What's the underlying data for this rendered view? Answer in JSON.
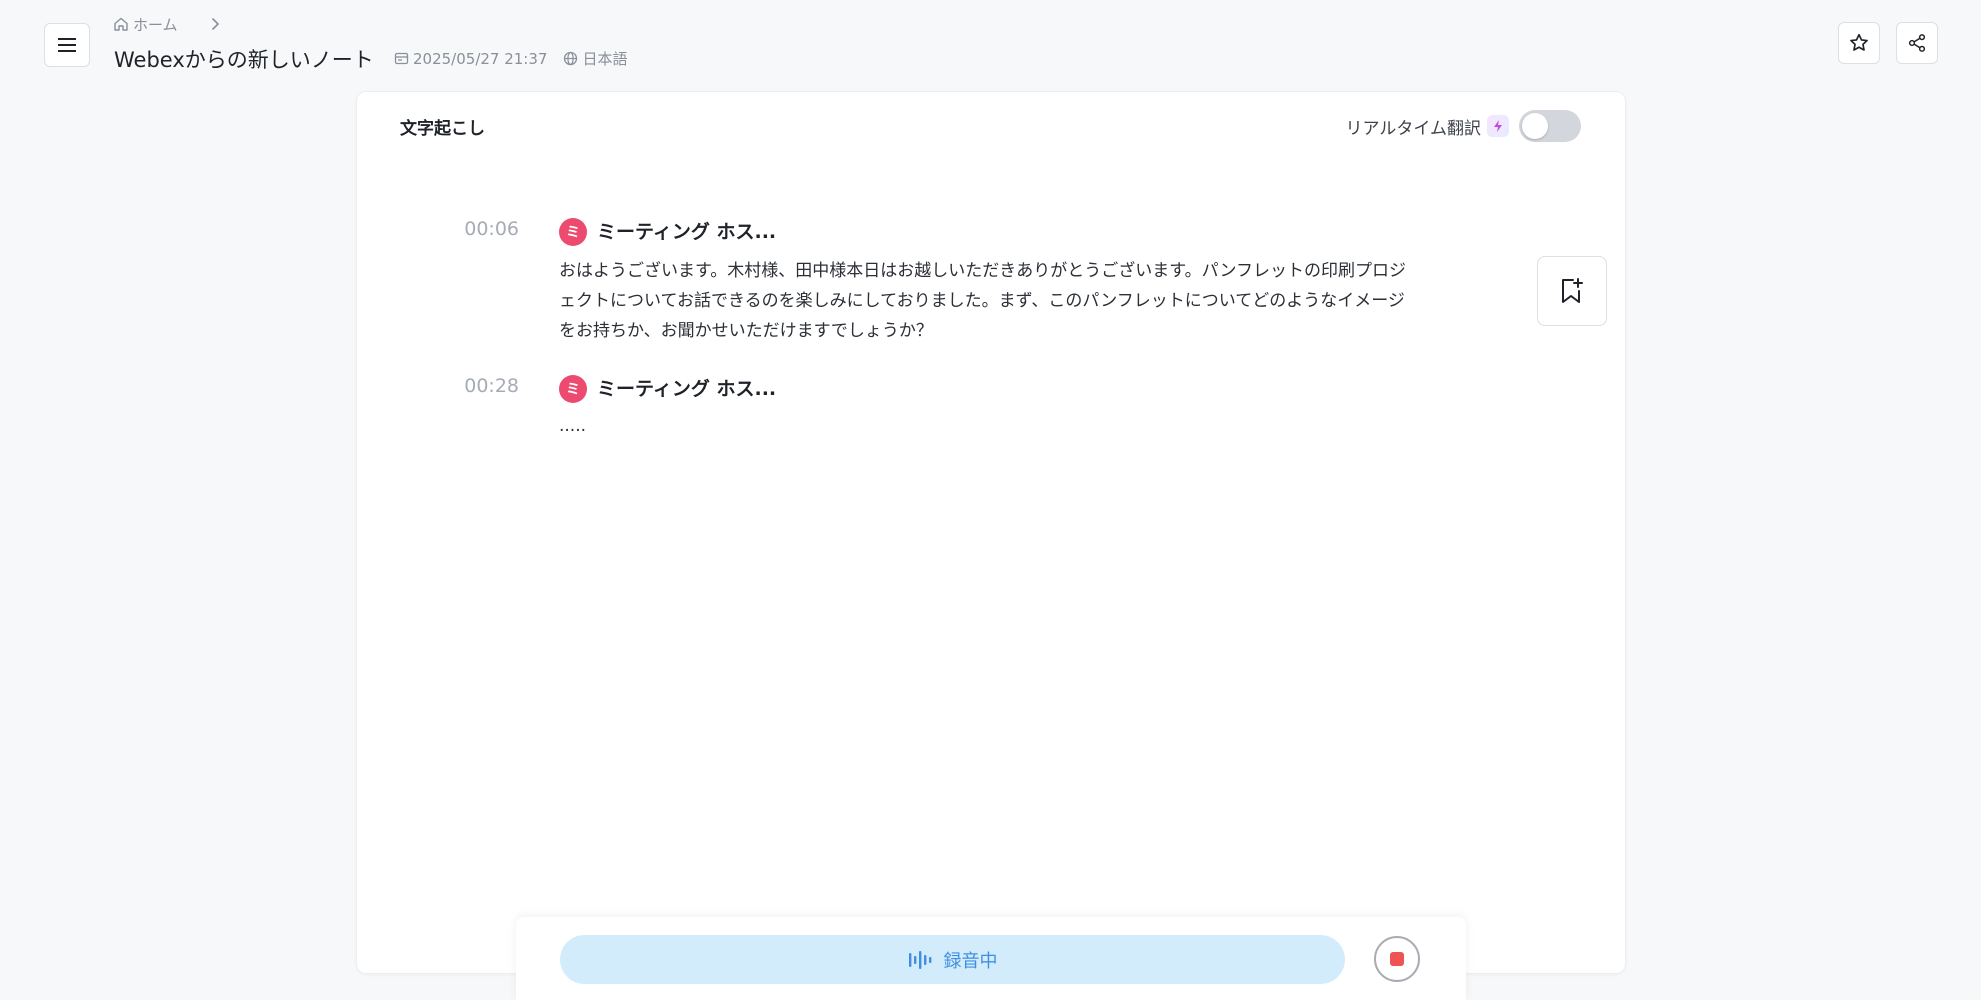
{
  "header": {
    "breadcrumb_home": "ホーム",
    "title": "Webexからの新しいノート",
    "datetime": "2025/05/27 21:37",
    "language": "日本語"
  },
  "transcript": {
    "title": "文字起こし",
    "realtime_translation_label": "リアルタイム翻訳",
    "realtime_translation_on": false,
    "entries": [
      {
        "time": "00:06",
        "speaker": "ミーティング ホス...",
        "avatar_letter": "ミ",
        "text": "おはようございます。木村様、田中様本日はお越しいただきありがとうございます。パンフレットの印刷プロジェクトについてお話できるのを楽しみにしておりました。まず、このパンフレットについてどのようなイメージをお持ちか、お聞かせいただけますでしょうか？"
      },
      {
        "time": "00:28",
        "speaker": "ミーティング ホス...",
        "avatar_letter": "ミ",
        "text": "....."
      }
    ]
  },
  "recording": {
    "status_label": "録音中"
  },
  "colors": {
    "accent_avatar": "#ec4b6f",
    "recording_bg": "#d3ecfc",
    "recording_text": "#3f8fe0",
    "stop": "#ee5454"
  },
  "icons": {
    "menu": "menu-icon",
    "home": "home-icon",
    "chevron": "chevron-right-icon",
    "calendar": "calendar-icon",
    "globe": "globe-icon",
    "star": "star-icon",
    "share": "share-icon",
    "sparkle": "sparkle-icon",
    "bookmark": "bookmark-add-icon",
    "waveform": "waveform-icon",
    "stop": "stop-icon"
  }
}
